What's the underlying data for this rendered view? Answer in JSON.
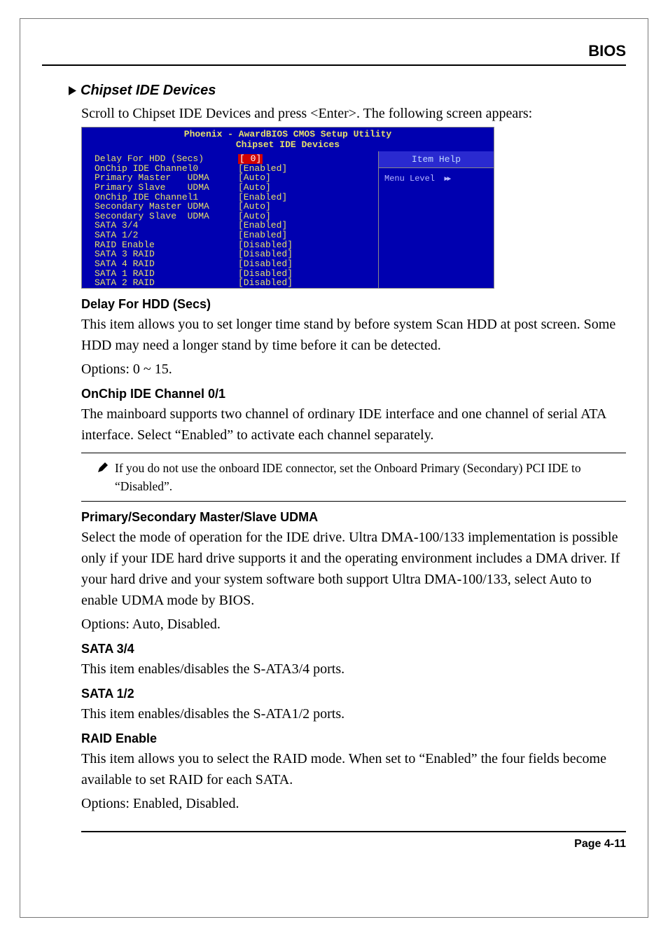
{
  "header": {
    "title": "BIOS"
  },
  "section": {
    "heading": "Chipset IDE Devices",
    "intro": "Scroll to Chipset IDE Devices and press <Enter>. The following screen appears:"
  },
  "bios": {
    "title_line1": "Phoenix - AwardBIOS CMOS Setup Utility",
    "title_line2": "Chipset IDE Devices",
    "help_header": "Item Help",
    "menu_level": "Menu Level",
    "rows": [
      {
        "label": "Delay For HDD (Secs)",
        "value": "[ 0]",
        "highlight": true
      },
      {
        "label": "OnChip IDE Channel0",
        "value": "[Enabled]"
      },
      {
        "label": "Primary Master   UDMA",
        "value": "[Auto]"
      },
      {
        "label": "Primary Slave    UDMA",
        "value": "[Auto]"
      },
      {
        "label": "OnChip IDE Channel1",
        "value": "[Enabled]"
      },
      {
        "label": "Secondary Master UDMA",
        "value": "[Auto]"
      },
      {
        "label": "Secondary Slave  UDMA",
        "value": "[Auto]"
      },
      {
        "label": "SATA 3/4",
        "value": "[Enabled]"
      },
      {
        "label": "SATA 1/2",
        "value": "[Enabled]"
      },
      {
        "label": "RAID Enable",
        "value": "[Disabled]"
      },
      {
        "label": "SATA 3 RAID",
        "value": "[Disabled]"
      },
      {
        "label": "SATA 4 RAID",
        "value": "[Disabled]"
      },
      {
        "label": "SATA 1 RAID",
        "value": "[Disabled]"
      },
      {
        "label": "SATA 2 RAID",
        "value": "[Disabled]"
      }
    ]
  },
  "subsections": {
    "delay_hdd": {
      "heading": "Delay For HDD (Secs)",
      "body": "This item allows you to set longer time stand by before system Scan HDD at post screen. Some HDD may need a longer stand by time before it can be detected.",
      "options": "Options: 0 ~  15."
    },
    "onchip": {
      "heading": "OnChip IDE Channel 0/1",
      "body": "The mainboard supports two channel of ordinary IDE interface and one channel of serial ATA interface. Select “Enabled” to activate each channel separately."
    },
    "note": "If you do not use the onboard IDE connector, set the Onboard Primary (Secondary) PCI IDE to “Disabled”.",
    "udma": {
      "heading": "Primary/Secondary Master/Slave UDMA",
      "body": "Select the mode of operation for the IDE drive. Ultra DMA-100/133 implementation is possible only if your IDE hard drive supports it and the operating environment includes a DMA driver. If your hard drive and your system software both support Ultra DMA-100/133, select Auto to enable UDMA mode by BIOS.",
      "options": "Options: Auto, Disabled."
    },
    "sata34": {
      "heading": "SATA 3/4",
      "body": "This item enables/disables the S-ATA3/4 ports."
    },
    "sata12": {
      "heading": "SATA 1/2",
      "body": "This item enables/disables the S-ATA1/2 ports."
    },
    "raid": {
      "heading": "RAID Enable",
      "body": "This item allows you to select the RAID mode.  When set to “Enabled” the four fields become available to set RAID for each SATA.",
      "options": "Options: Enabled, Disabled."
    }
  },
  "footer": {
    "page": "Page 4-11"
  }
}
